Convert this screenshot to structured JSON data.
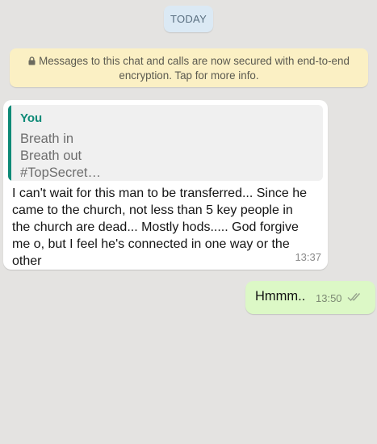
{
  "date_divider": "TODAY",
  "encryption_notice": {
    "line1": "Messages to this chat and calls are now secured with end-to-end",
    "line2": "encryption. Tap for more info.",
    "icon": "lock-icon"
  },
  "messages": [
    {
      "direction": "incoming",
      "quoted": {
        "author": "You",
        "lines": [
          "Breath in",
          "Breath out",
          "#TopSecret…"
        ]
      },
      "lines": [
        "I can't wait for this man to be transferred... Since he",
        "came to the church, not less than 5 key people in",
        "the church are dead... Mostly hods..... God forgive",
        "me o, but I feel he's connected in one way or the",
        "other"
      ],
      "time": "13:37"
    },
    {
      "direction": "outgoing",
      "text": "Hmmm..",
      "time": "13:50",
      "status_icon": "double-check-icon"
    }
  ],
  "colors": {
    "chat_background": "#e4e3e1",
    "outgoing_bubble": "#dcf8c6",
    "quote_accent": "#0e8a77",
    "encryption_banner": "#fbf0c4",
    "date_chip": "#dbe9f4"
  }
}
